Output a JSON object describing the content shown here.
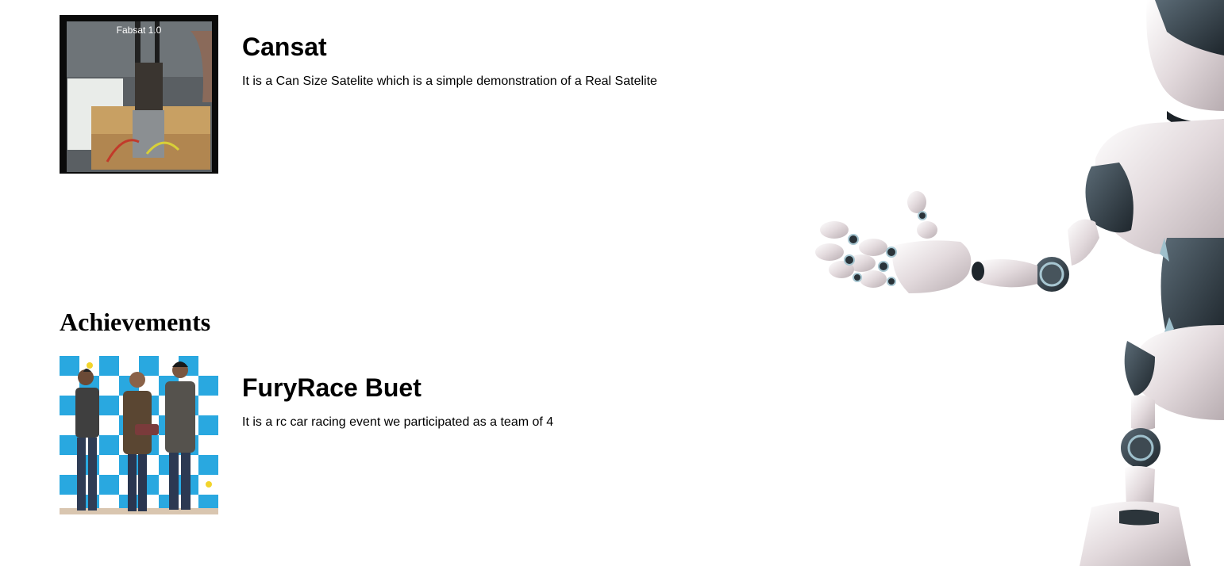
{
  "projects": [
    {
      "title": "Cansat",
      "description": "It is a Can Size Satelite which is a simple demonstration of a Real Satelite",
      "image_label": "Fabsat 1.0"
    }
  ],
  "achievements": {
    "heading": "Achievements",
    "items": [
      {
        "title": "FuryRace Buet",
        "description": "It is a rc car racing event we participated as a team of 4"
      }
    ]
  },
  "colors": {
    "background": "#ffffff",
    "text": "#000000",
    "robot_body": "#e4dcdf",
    "robot_dark": "#2f3a42",
    "backdrop_blue": "#29a8e0"
  }
}
